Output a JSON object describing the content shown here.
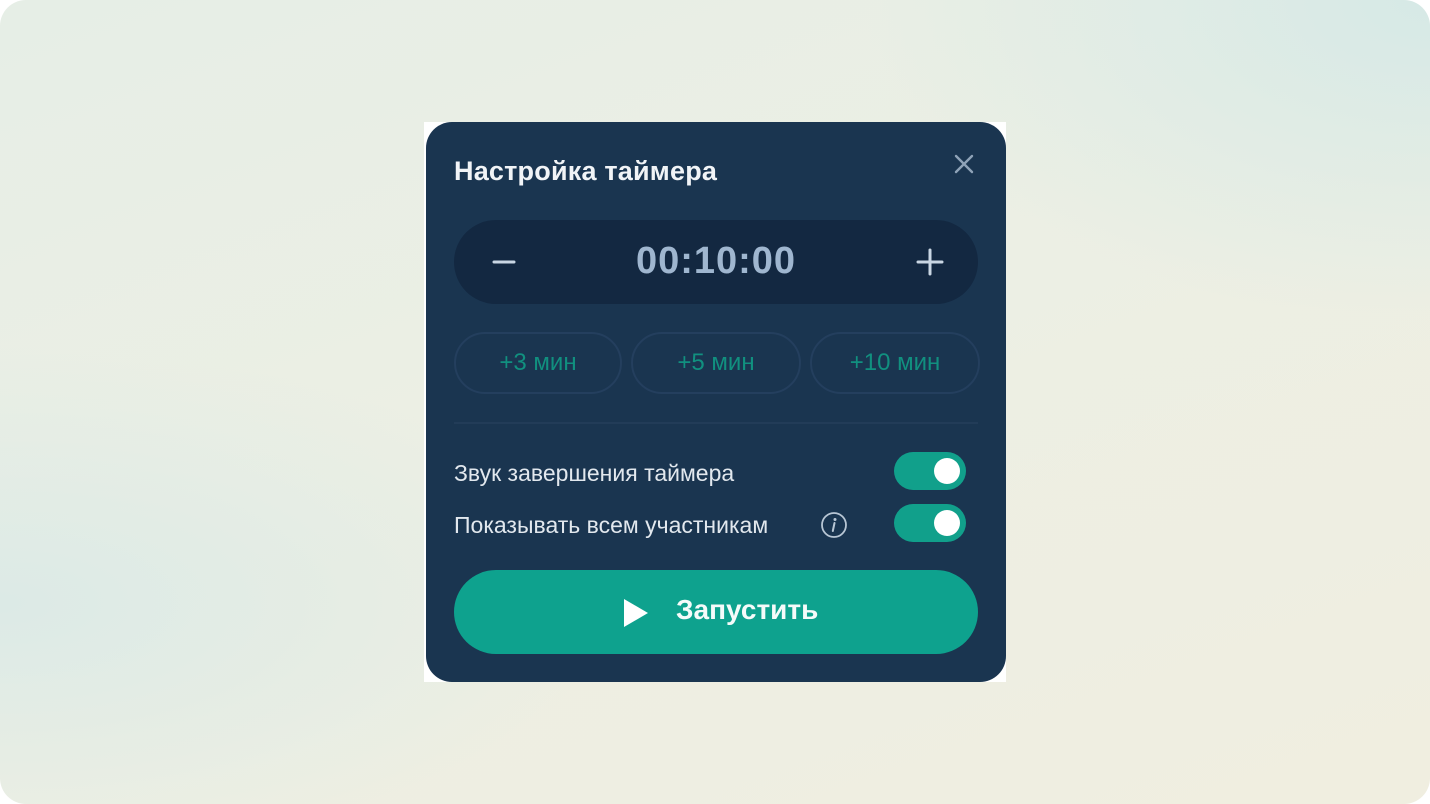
{
  "timer_panel": {
    "title": "Настройка таймера",
    "time_value": "00:10:00",
    "presets": [
      "+3 мин",
      "+5 мин",
      "+10 мин"
    ],
    "options": [
      {
        "label": "Звук завершения таймера",
        "enabled": true
      },
      {
        "label": "Показывать всем участникам",
        "enabled": true
      }
    ],
    "start_label": "Запустить"
  },
  "icons": {
    "close": "close-icon",
    "minus": "minus-icon",
    "plus": "plus-icon",
    "info": "info-icon",
    "play": "play-icon"
  },
  "colors": {
    "panel_bg": "#1a3550",
    "stepper_bg": "#132841",
    "accent": "#0ea28e",
    "preset_text": "#11907f",
    "time_text": "#9fb6cf"
  }
}
